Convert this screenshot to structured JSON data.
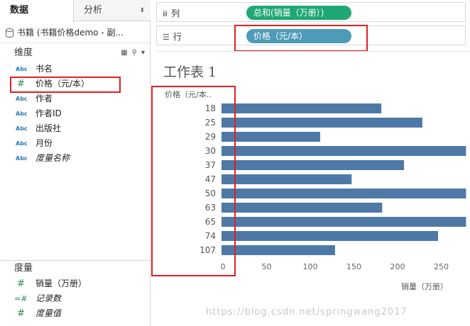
{
  "tabs": {
    "data": "数据",
    "analysis": "分析"
  },
  "datasource": {
    "label": "书籍 (书籍价格demo - 副..."
  },
  "dimensions": {
    "header": "维度",
    "fields": [
      {
        "type": "Abc",
        "label": "书名"
      },
      {
        "type": "#",
        "label": "价格（元/本）"
      },
      {
        "type": "Abc",
        "label": "作者"
      },
      {
        "type": "Abc",
        "label": "作者ID"
      },
      {
        "type": "Abc",
        "label": "出版社"
      },
      {
        "type": "Abc",
        "label": "月份"
      },
      {
        "type": "Abc",
        "label": "度量名称"
      }
    ]
  },
  "measures": {
    "header": "度量",
    "fields": [
      {
        "type": "#",
        "label": "销量（万册）"
      },
      {
        "type": "=#",
        "label": "记录数"
      },
      {
        "type": "#",
        "label": "度量值"
      }
    ]
  },
  "shelves": {
    "columns": {
      "label": "列",
      "pill": "总和(销量（万册）)"
    },
    "rows": {
      "label": "行",
      "pill": "价格（元/本）"
    }
  },
  "sheet": {
    "title": "工作表 1"
  },
  "watermark": "https://blog.csdn.net/springwang2017",
  "chart_data": {
    "type": "bar",
    "orientation": "horizontal",
    "ylabel": "价格（元/本..",
    "xlabel": "销量（万册）",
    "categories": [
      "18",
      "25",
      "29",
      "30",
      "37",
      "47",
      "50",
      "63",
      "65",
      "74",
      "107"
    ],
    "values": [
      183,
      230,
      113,
      280,
      209,
      149,
      280,
      184,
      280,
      248,
      130
    ],
    "xticks": [
      0,
      50,
      100,
      150,
      200,
      250
    ],
    "xlim": [
      0,
      275
    ],
    "bar_color": "#4e79a7"
  }
}
